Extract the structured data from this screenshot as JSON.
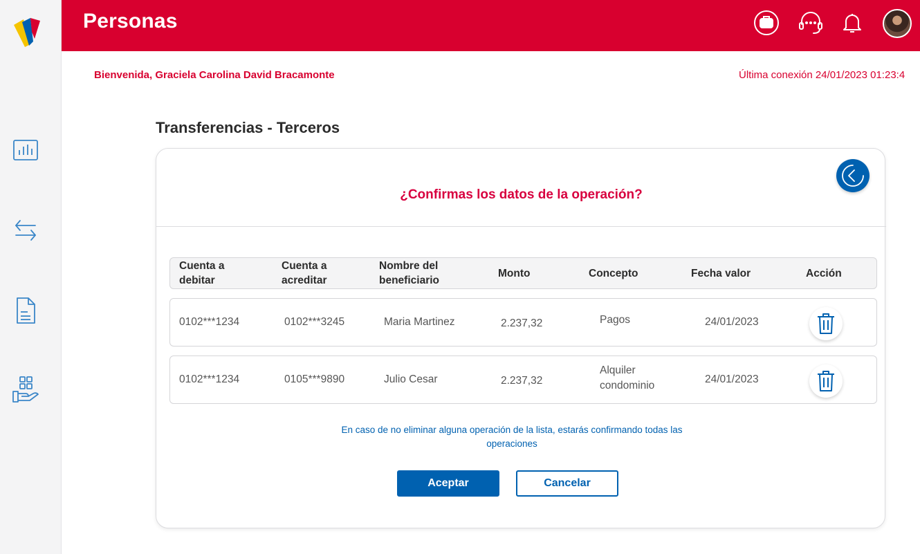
{
  "app": {
    "brand_title": "Personas",
    "colors": {
      "brand_red": "#d8002f",
      "primary_blue": "#0061b0",
      "sidebar_bg": "#f4f4f5"
    }
  },
  "sidebar": {
    "items": [
      {
        "icon": "chart-icon"
      },
      {
        "icon": "transfer-arrows-icon"
      },
      {
        "icon": "document-icon"
      },
      {
        "icon": "products-hand-icon"
      }
    ]
  },
  "topbar": {
    "icons": [
      "briefcase-icon",
      "support-headset-icon",
      "bell-icon",
      "user-avatar"
    ]
  },
  "header": {
    "welcome": "Bienvenida, Graciela Carolina David Bracamonte",
    "last_connection": "Última conexión 24/01/2023 01:23:4"
  },
  "main": {
    "page_title": "Transferencias - Terceros",
    "question": "¿Confirmas los datos de la operación?",
    "table": {
      "headers": {
        "debit": "Cuenta a debitar",
        "credit": "Cuenta a acreditar",
        "beneficiary": "Nombre del beneficiario",
        "amount": "Monto",
        "concept": "Concepto",
        "date": "Fecha valor",
        "action": "Acción"
      },
      "rows": [
        {
          "debit": "0102***1234",
          "credit": "0102***3245",
          "beneficiary": "Maria Martinez",
          "amount": "2.237,32",
          "concept": "Pagos",
          "date": "24/01/2023"
        },
        {
          "debit": "0102***1234",
          "credit": "0105***9890",
          "beneficiary": "Julio Cesar",
          "amount": "2.237,32",
          "concept": "Alquiler condominio",
          "date": "24/01/2023"
        }
      ]
    },
    "note": "En caso de no eliminar alguna operación de la lista, estarás confirmando todas las operaciones",
    "buttons": {
      "accept": "Aceptar",
      "cancel": "Cancelar"
    }
  }
}
